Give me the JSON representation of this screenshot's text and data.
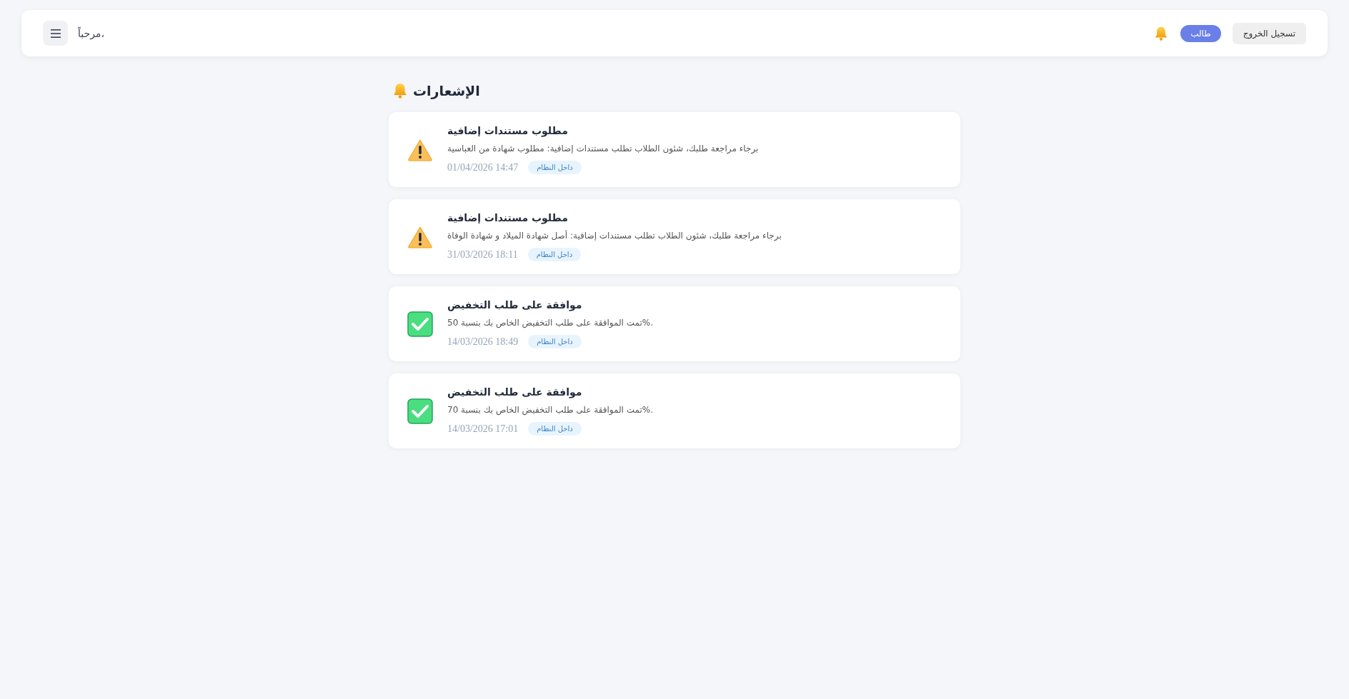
{
  "header": {
    "greeting": "مرحباً،",
    "role_badge": "طالب",
    "logout_button": "تسجيل الخروج"
  },
  "page_title": "الإشعارات",
  "notifications": [
    {
      "kind": "warning",
      "title": "مطلوب مستندات إضافية",
      "message": "برجاء مراجعة طلبك، شئون الطلاب تطلب مستندات إضافية: مطلوب شهادة من العباسية",
      "date": "01/04/2026 14:47",
      "tag": "داخل النظام"
    },
    {
      "kind": "warning",
      "title": "مطلوب مستندات إضافية",
      "message": "برجاء مراجعة طلبك، شئون الطلاب تطلب مستندات إضافية: أصل شهادة الميلاد و شهادة الوفاة",
      "date": "31/03/2026 18:11",
      "tag": "داخل النظام"
    },
    {
      "kind": "success",
      "title": "موافقة على طلب التخفيض",
      "message": "تمت الموافقة على طلب التخفيض الخاص بك بنسبة 50%.",
      "date": "14/03/2026 18:49",
      "tag": "داخل النظام"
    },
    {
      "kind": "success",
      "title": "موافقة على طلب التخفيض",
      "message": "تمت الموافقة على طلب التخفيض الخاص بك بنسبة 70%.",
      "date": "14/03/2026 17:01",
      "tag": "داخل النظام"
    }
  ]
}
